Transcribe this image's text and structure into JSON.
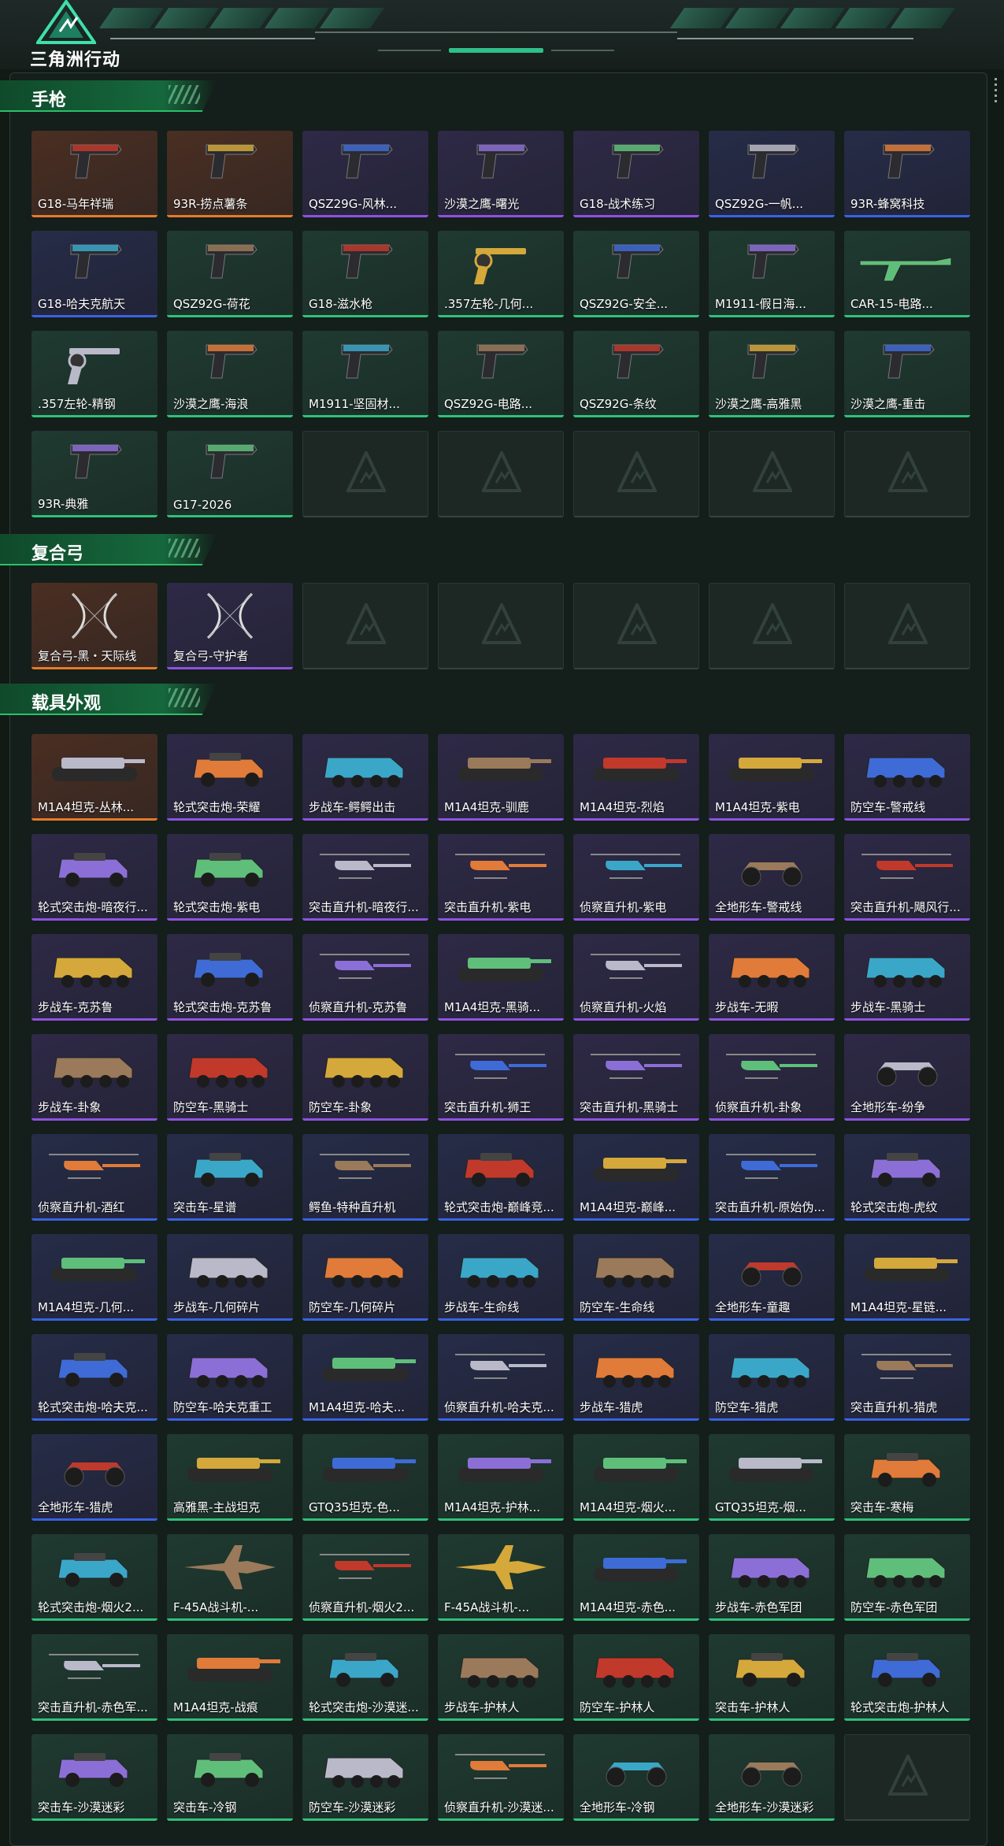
{
  "header": {
    "logo_text": "三角洲行动"
  },
  "sections": [
    {
      "title": "手枪",
      "items": [
        {
          "name": "G18-马年祥瑞",
          "rarity": "orange",
          "kind": "pistol"
        },
        {
          "name": "93R-捞点薯条",
          "rarity": "orange",
          "kind": "pistol"
        },
        {
          "name": "QSZ29G-风林...",
          "rarity": "purple",
          "kind": "pistol"
        },
        {
          "name": "沙漠之鹰-曙光",
          "rarity": "purple",
          "kind": "pistol"
        },
        {
          "name": "G18-战术练习",
          "rarity": "purple",
          "kind": "pistol"
        },
        {
          "name": "QSZ92G-一帆...",
          "rarity": "blue",
          "kind": "pistol"
        },
        {
          "name": "93R-蜂窝科技",
          "rarity": "blue",
          "kind": "pistol"
        },
        {
          "name": "G18-哈夫克航天",
          "rarity": "blue",
          "kind": "pistol"
        },
        {
          "name": "QSZ92G-荷花",
          "rarity": "green",
          "kind": "pistol"
        },
        {
          "name": "G18-滋水枪",
          "rarity": "green",
          "kind": "pistol"
        },
        {
          "name": ".357左轮-几何...",
          "rarity": "green",
          "kind": "revolver"
        },
        {
          "name": "QSZ92G-安全...",
          "rarity": "green",
          "kind": "pistol"
        },
        {
          "name": "M1911-假日海...",
          "rarity": "green",
          "kind": "pistol"
        },
        {
          "name": "CAR-15-电路...",
          "rarity": "green",
          "kind": "rifle"
        },
        {
          "name": ".357左轮-精钢",
          "rarity": "green",
          "kind": "revolver"
        },
        {
          "name": "沙漠之鹰-海浪",
          "rarity": "green",
          "kind": "pistol"
        },
        {
          "name": "M1911-坚固材...",
          "rarity": "green",
          "kind": "pistol"
        },
        {
          "name": "QSZ92G-电路...",
          "rarity": "green",
          "kind": "pistol"
        },
        {
          "name": "QSZ92G-条纹",
          "rarity": "green",
          "kind": "pistol"
        },
        {
          "name": "沙漠之鹰-高雅黑",
          "rarity": "green",
          "kind": "pistol"
        },
        {
          "name": "沙漠之鹰-重击",
          "rarity": "green",
          "kind": "pistol"
        },
        {
          "name": "93R-典雅",
          "rarity": "green",
          "kind": "pistol"
        },
        {
          "name": "G17-2026",
          "rarity": "green",
          "kind": "pistol"
        },
        {
          "name": "",
          "rarity": "empty"
        },
        {
          "name": "",
          "rarity": "empty"
        },
        {
          "name": "",
          "rarity": "empty"
        },
        {
          "name": "",
          "rarity": "empty"
        },
        {
          "name": "",
          "rarity": "empty"
        }
      ]
    },
    {
      "title": "复合弓",
      "items": [
        {
          "name": "复合弓-黑・天际线",
          "rarity": "orange",
          "kind": "bow"
        },
        {
          "name": "复合弓-守护者",
          "rarity": "purple",
          "kind": "bow"
        },
        {
          "name": "",
          "rarity": "empty"
        },
        {
          "name": "",
          "rarity": "empty"
        },
        {
          "name": "",
          "rarity": "empty"
        },
        {
          "name": "",
          "rarity": "empty"
        },
        {
          "name": "",
          "rarity": "empty"
        }
      ]
    },
    {
      "title": "载具外观",
      "items": [
        {
          "name": "M1A4坦克-丛林...",
          "rarity": "orange",
          "kind": "tank"
        },
        {
          "name": "轮式突击炮-荣耀",
          "rarity": "purple",
          "kind": "car"
        },
        {
          "name": "步战车-鳄鳄出击",
          "rarity": "purple",
          "kind": "apc"
        },
        {
          "name": "M1A4坦克-驯鹿",
          "rarity": "purple",
          "kind": "tank"
        },
        {
          "name": "M1A4坦克-烈焰",
          "rarity": "purple",
          "kind": "tank"
        },
        {
          "name": "M1A4坦克-紫电",
          "rarity": "purple",
          "kind": "tank"
        },
        {
          "name": "防空车-警戒线",
          "rarity": "purple",
          "kind": "apc"
        },
        {
          "name": "轮式突击炮-暗夜行...",
          "rarity": "purple",
          "kind": "car"
        },
        {
          "name": "轮式突击炮-紫电",
          "rarity": "purple",
          "kind": "car"
        },
        {
          "name": "突击直升机-暗夜行...",
          "rarity": "purple",
          "kind": "heli"
        },
        {
          "name": "突击直升机-紫电",
          "rarity": "purple",
          "kind": "heli"
        },
        {
          "name": "侦察直升机-紫电",
          "rarity": "purple",
          "kind": "heli"
        },
        {
          "name": "全地形车-警戒线",
          "rarity": "purple",
          "kind": "atv"
        },
        {
          "name": "突击直升机-飓风行...",
          "rarity": "purple",
          "kind": "heli"
        },
        {
          "name": "步战车-克苏鲁",
          "rarity": "purple",
          "kind": "apc"
        },
        {
          "name": "轮式突击炮-克苏鲁",
          "rarity": "purple",
          "kind": "car"
        },
        {
          "name": "侦察直升机-克苏鲁",
          "rarity": "purple",
          "kind": "heli"
        },
        {
          "name": "M1A4坦克-黑骑...",
          "rarity": "purple",
          "kind": "tank"
        },
        {
          "name": "侦察直升机-火焰",
          "rarity": "purple",
          "kind": "heli"
        },
        {
          "name": "步战车-无暇",
          "rarity": "purple",
          "kind": "apc"
        },
        {
          "name": "步战车-黑骑士",
          "rarity": "purple",
          "kind": "apc"
        },
        {
          "name": "步战车-卦象",
          "rarity": "purple",
          "kind": "apc"
        },
        {
          "name": "防空车-黑骑士",
          "rarity": "purple",
          "kind": "apc"
        },
        {
          "name": "防空车-卦象",
          "rarity": "purple",
          "kind": "apc"
        },
        {
          "name": "突击直升机-狮王",
          "rarity": "purple",
          "kind": "heli"
        },
        {
          "name": "突击直升机-黑骑士",
          "rarity": "purple",
          "kind": "heli"
        },
        {
          "name": "侦察直升机-卦象",
          "rarity": "purple",
          "kind": "heli"
        },
        {
          "name": "全地形车-纷争",
          "rarity": "purple",
          "kind": "atv"
        },
        {
          "name": "侦察直升机-酒红",
          "rarity": "blue",
          "kind": "heli"
        },
        {
          "name": "突击车-星谱",
          "rarity": "blue",
          "kind": "car"
        },
        {
          "name": "鳄鱼-特种直升机",
          "rarity": "blue",
          "kind": "heli"
        },
        {
          "name": "轮式突击炮-巅峰竞...",
          "rarity": "blue",
          "kind": "car"
        },
        {
          "name": "M1A4坦克-巅峰...",
          "rarity": "blue",
          "kind": "tank"
        },
        {
          "name": "突击直升机-原始伪...",
          "rarity": "blue",
          "kind": "heli"
        },
        {
          "name": "轮式突击炮-虎纹",
          "rarity": "blue",
          "kind": "car"
        },
        {
          "name": "M1A4坦克-几何...",
          "rarity": "blue",
          "kind": "tank"
        },
        {
          "name": "步战车-几何碎片",
          "rarity": "blue",
          "kind": "apc"
        },
        {
          "name": "防空车-几何碎片",
          "rarity": "blue",
          "kind": "apc"
        },
        {
          "name": "步战车-生命线",
          "rarity": "blue",
          "kind": "apc"
        },
        {
          "name": "防空车-生命线",
          "rarity": "blue",
          "kind": "apc"
        },
        {
          "name": "全地形车-童趣",
          "rarity": "blue",
          "kind": "atv"
        },
        {
          "name": "M1A4坦克-星链...",
          "rarity": "blue",
          "kind": "tank"
        },
        {
          "name": "轮式突击炮-哈夫克...",
          "rarity": "blue",
          "kind": "car"
        },
        {
          "name": "防空车-哈夫克重工",
          "rarity": "blue",
          "kind": "apc"
        },
        {
          "name": "M1A4坦克-哈夫...",
          "rarity": "blue",
          "kind": "tank"
        },
        {
          "name": "侦察直升机-哈夫克...",
          "rarity": "blue",
          "kind": "heli"
        },
        {
          "name": "步战车-猎虎",
          "rarity": "blue",
          "kind": "apc"
        },
        {
          "name": "防空车-猎虎",
          "rarity": "blue",
          "kind": "apc"
        },
        {
          "name": "突击直升机-猎虎",
          "rarity": "blue",
          "kind": "heli"
        },
        {
          "name": "全地形车-猎虎",
          "rarity": "blue",
          "kind": "atv"
        },
        {
          "name": "高雅黑-主战坦克",
          "rarity": "green",
          "kind": "tank"
        },
        {
          "name": "GTQ35坦克-色...",
          "rarity": "green",
          "kind": "tank"
        },
        {
          "name": "M1A4坦克-护林...",
          "rarity": "green",
          "kind": "tank"
        },
        {
          "name": "M1A4坦克-烟火...",
          "rarity": "green",
          "kind": "tank"
        },
        {
          "name": "GTQ35坦克-烟...",
          "rarity": "green",
          "kind": "tank"
        },
        {
          "name": "突击车-寒梅",
          "rarity": "green",
          "kind": "car"
        },
        {
          "name": "轮式突击炮-烟火2...",
          "rarity": "green",
          "kind": "car"
        },
        {
          "name": "F-45A战斗机-...",
          "rarity": "green",
          "kind": "jet"
        },
        {
          "name": "侦察直升机-烟火2...",
          "rarity": "green",
          "kind": "heli"
        },
        {
          "name": "F-45A战斗机-...",
          "rarity": "green",
          "kind": "jet"
        },
        {
          "name": "M1A4坦克-赤色...",
          "rarity": "green",
          "kind": "tank"
        },
        {
          "name": "步战车-赤色军团",
          "rarity": "green",
          "kind": "apc"
        },
        {
          "name": "防空车-赤色军团",
          "rarity": "green",
          "kind": "apc"
        },
        {
          "name": "突击直升机-赤色军...",
          "rarity": "green",
          "kind": "heli"
        },
        {
          "name": "M1A4坦克-战痕",
          "rarity": "green",
          "kind": "tank"
        },
        {
          "name": "轮式突击炮-沙漠迷...",
          "rarity": "green",
          "kind": "car"
        },
        {
          "name": "步战车-护林人",
          "rarity": "green",
          "kind": "apc"
        },
        {
          "name": "防空车-护林人",
          "rarity": "green",
          "kind": "apc"
        },
        {
          "name": "突击车-护林人",
          "rarity": "green",
          "kind": "car"
        },
        {
          "name": "轮式突击炮-护林人",
          "rarity": "green",
          "kind": "car"
        },
        {
          "name": "突击车-沙漠迷彩",
          "rarity": "green",
          "kind": "car"
        },
        {
          "name": "突击车-冷钢",
          "rarity": "green",
          "kind": "car"
        },
        {
          "name": "防空车-沙漠迷彩",
          "rarity": "green",
          "kind": "apc"
        },
        {
          "name": "侦察直升机-沙漠迷...",
          "rarity": "green",
          "kind": "heli"
        },
        {
          "name": "全地形车-冷钢",
          "rarity": "green",
          "kind": "atv"
        },
        {
          "name": "全地形车-沙漠迷彩",
          "rarity": "green",
          "kind": "atv"
        },
        {
          "name": "",
          "rarity": "empty"
        }
      ]
    }
  ],
  "colors": {
    "background": "#121a16",
    "rarity_orange": "#e57a2a",
    "rarity_purple": "#8e52e0",
    "rarity_blue": "#3a62e6",
    "rarity_green": "#2fc07a",
    "accent": "#2fbf8a"
  }
}
